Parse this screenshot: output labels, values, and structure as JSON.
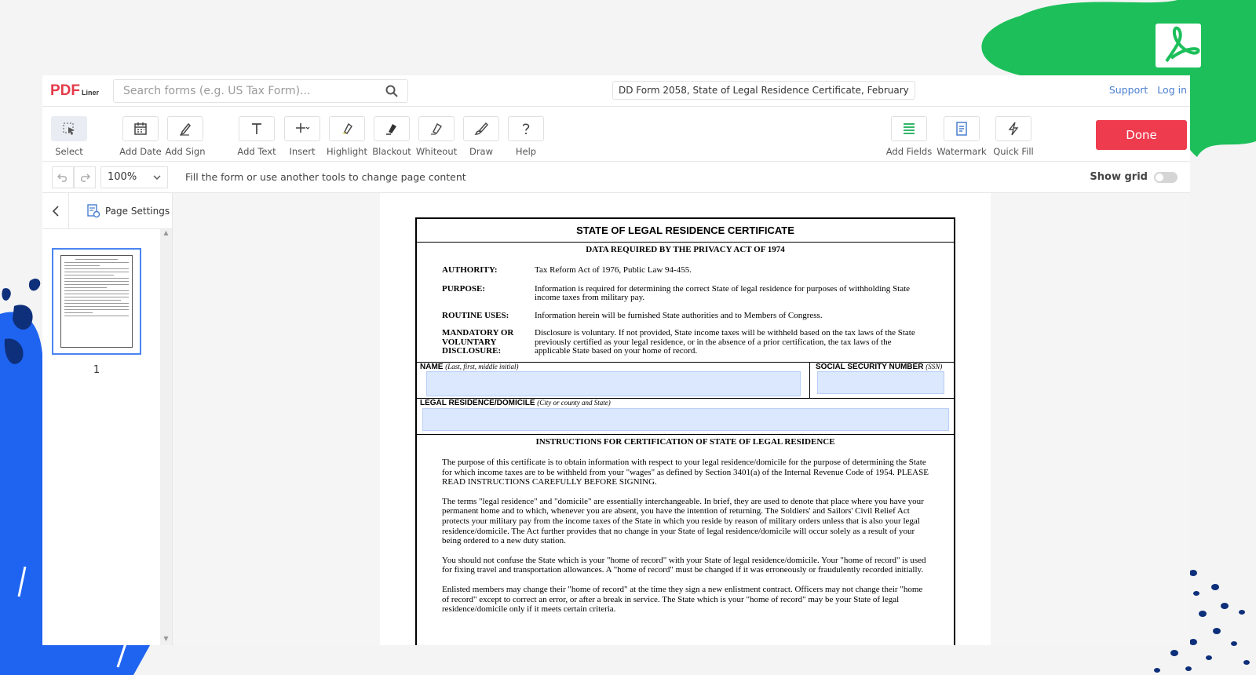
{
  "brand": {
    "logo_main": "PDF",
    "logo_sub": "Liner"
  },
  "search": {
    "placeholder": "Search forms (e.g. US Tax Form)..."
  },
  "document": {
    "title": "DD Form 2058, State of Legal Residence Certificate, February"
  },
  "header_links": {
    "support": "Support",
    "login": "Log in"
  },
  "toolbar": {
    "tools": [
      {
        "label": "Select",
        "icon": "cursor-icon"
      },
      {
        "label": "Add Date",
        "icon": "calendar-icon"
      },
      {
        "label": "Add Sign",
        "icon": "pen-icon"
      },
      {
        "label": "Add Text",
        "icon": "text-icon"
      },
      {
        "label": "Insert",
        "icon": "plus-icon"
      },
      {
        "label": "Highlight",
        "icon": "highlighter-icon"
      },
      {
        "label": "Blackout",
        "icon": "blackout-icon"
      },
      {
        "label": "Whiteout",
        "icon": "whiteout-icon"
      },
      {
        "label": "Draw",
        "icon": "brush-icon"
      },
      {
        "label": "Help",
        "icon": "question-icon"
      },
      {
        "label": "Add Fields",
        "icon": "fields-icon"
      },
      {
        "label": "Watermark",
        "icon": "watermark-icon"
      },
      {
        "label": "Quick Fill",
        "icon": "lightning-icon"
      }
    ],
    "done_label": "Done"
  },
  "subbar": {
    "zoom": "100%",
    "hint": "Fill the form or use another tools to change page content",
    "show_grid": "Show grid"
  },
  "sidebar": {
    "page_settings": "Page Settings",
    "page_number": "1"
  },
  "form": {
    "title": "STATE OF LEGAL RESIDENCE CERTIFICATE",
    "privacy_header": "DATA REQUIRED BY THE PRIVACY ACT OF 1974",
    "privacy_rows": [
      {
        "key": "AUTHORITY:",
        "value": "Tax Reform Act of 1976, Public Law 94-455."
      },
      {
        "key": "PURPOSE:",
        "value": "Information is required for determining the correct State of legal residence for purposes of withholding State income taxes from military pay."
      },
      {
        "key": "ROUTINE USES:",
        "value": "Information herein will be furnished State authorities and to Members of Congress."
      },
      {
        "key": "MANDATORY OR VOLUNTARY DISCLOSURE:",
        "value": "Disclosure is voluntary.  If not provided, State income taxes will be withheld based on the tax laws of the State previously certified as your legal residence, or in the absence of a prior certification, the tax laws of the applicable State based on your home of record."
      }
    ],
    "name_label": "NAME",
    "name_hint": "(Last, first, middle initial)",
    "ssn_label": "SOCIAL SECURITY NUMBER",
    "ssn_hint": "(SSN)",
    "residence_label": "LEGAL RESIDENCE/DOMICILE",
    "residence_hint": "(City or county and State)",
    "instructions_title": "INSTRUCTIONS FOR CERTIFICATION OF STATE OF LEGAL RESIDENCE",
    "paragraphs": [
      "The purpose of this certificate is to obtain information with respect to your legal residence/domicile for the purpose of determining the State for which income taxes are to be withheld from your \"wages\" as defined by Section 3401(a) of the Internal Revenue Code of 1954.  PLEASE READ INSTRUCTIONS CAREFULLY BEFORE SIGNING.",
      "The terms \"legal residence\" and \"domicile\" are essentially interchangeable.  In brief, they are used to denote that place where you have your permanent home and to which, whenever you are absent, you have the intention of returning.  The Soldiers' and Sailors' Civil Relief Act protects your military pay from the income taxes of the State in which you reside by reason of military orders unless that is also your legal residence/domicile.  The Act further provides that no change in your State of legal residence/domicile will occur solely as a result of your being ordered to a new duty station.",
      "You should not confuse the State which is your \"home of record\" with your State of legal residence/domicile.  Your \"home of record\" is used for fixing travel and transportation allowances.  A \"home of record\" must be changed if it was erroneously or fraudulently recorded initially.",
      "Enlisted members may change their \"home of record\" at the time they sign a new enlistment contract.  Officers may not change their \"home of record\" except to correct an error, or after a break in service.  The State which is your \"home of record\" may be your State of legal residence/domicile only if it meets certain criteria."
    ]
  },
  "colors": {
    "done": "#ef3b4e",
    "link": "#4a7fd0",
    "field_fill": "#dbe8fd",
    "green_deco": "#1dbf5a",
    "blue_deco": "#1f64f0"
  }
}
